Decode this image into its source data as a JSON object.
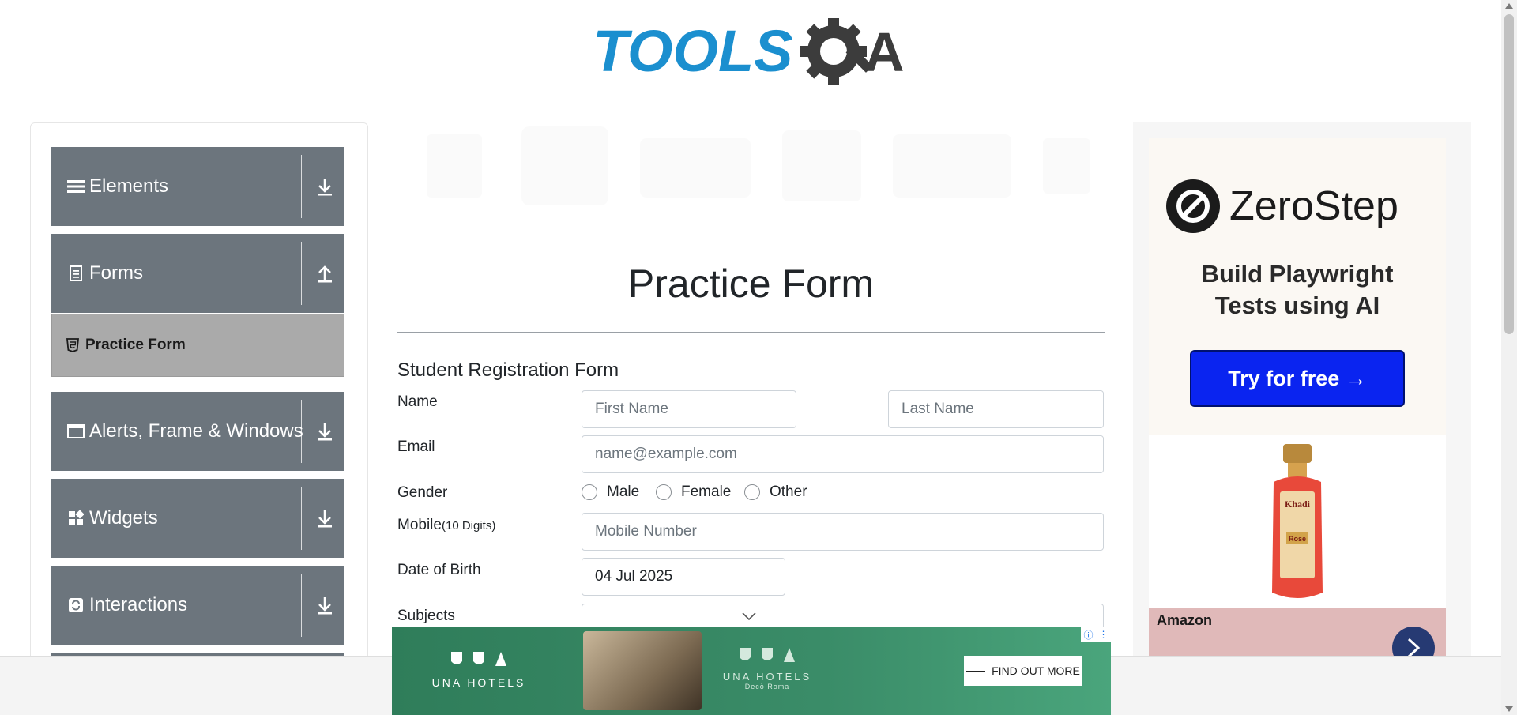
{
  "header": {
    "logo_text_left": "TOOLS",
    "logo_text_right": "A"
  },
  "sidebar": {
    "groups": [
      {
        "label": "Elements",
        "icon": "hamburger-icon",
        "arrow": "download-arrow-icon"
      },
      {
        "label": "Forms",
        "icon": "document-icon",
        "arrow": "upload-arrow-icon"
      },
      {
        "label": "Alerts, Frame & Windows",
        "icon": "window-icon",
        "arrow": "download-arrow-icon"
      },
      {
        "label": "Widgets",
        "icon": "grid-icon",
        "arrow": "download-arrow-icon"
      },
      {
        "label": "Interactions",
        "icon": "refresh-icon",
        "arrow": "download-arrow-icon"
      }
    ],
    "active_subitem": {
      "label": "Practice Form",
      "icon": "html5-icon"
    }
  },
  "main": {
    "page_title": "Practice Form",
    "form_heading": "Student Registration Form",
    "fields": {
      "name_label": "Name",
      "first_name_placeholder": "First Name",
      "last_name_placeholder": "Last Name",
      "email_label": "Email",
      "email_placeholder": "name@example.com",
      "gender_label": "Gender",
      "gender_options": [
        "Male",
        "Female",
        "Other"
      ],
      "mobile_label": "Mobile",
      "mobile_hint": "(10 Digits)",
      "mobile_placeholder": "Mobile Number",
      "dob_label": "Date of Birth",
      "dob_value": "04 Jul 2025",
      "subjects_label": "Subjects"
    }
  },
  "right_ad": {
    "brand": "ZeroStep",
    "tagline_line1": "Build Playwright",
    "tagline_line2": "Tests using AI",
    "cta": "Try for free →",
    "product_brand": "Khadi",
    "product_variant": "Rose",
    "store_label": "Amazon"
  },
  "bottom_ad": {
    "brand": "UNA HOTELS",
    "sub_brand": "Decò Roma",
    "cta": "FIND OUT MORE"
  },
  "colors": {
    "sidebar_group": "#6c757d",
    "sidebar_active": "#aaaaaa",
    "logo_blue": "#1b8fcf",
    "logo_dark": "#3c3c3c",
    "ad_button": "#0a24f0",
    "ad_green": "#2f7d5a"
  }
}
